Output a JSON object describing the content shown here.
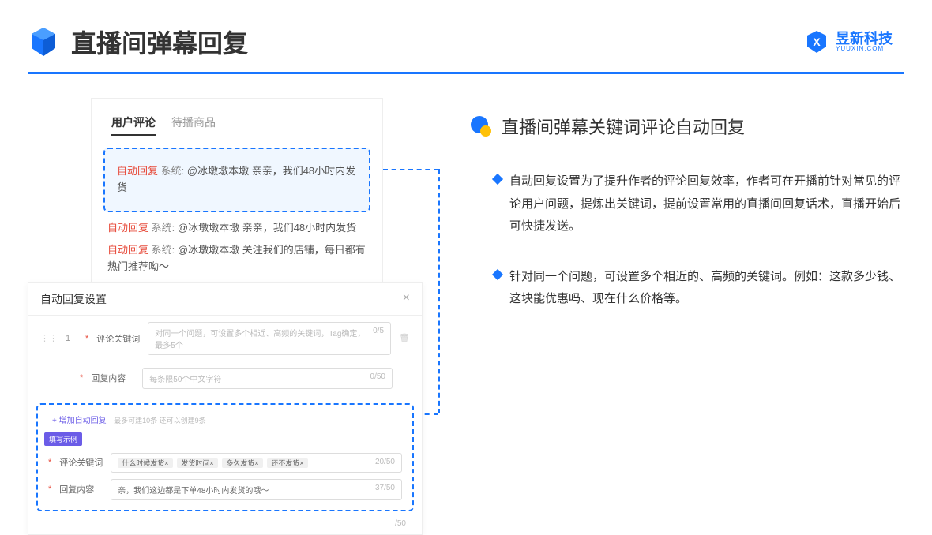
{
  "header": {
    "title": "直播间弹幕回复",
    "logo_name": "昱新科技",
    "logo_url": "YUUXIN.COM"
  },
  "comments": {
    "tab_active": "用户评论",
    "tab_inactive": "待播商品",
    "highlighted": {
      "tag": "自动回复",
      "sys": "系统:",
      "msg": "@冰墩墩本墩 亲亲，我们48小时内发货"
    },
    "line2": {
      "tag": "自动回复",
      "sys": "系统:",
      "msg": "@冰墩墩本墩 亲亲，我们48小时内发货"
    },
    "line3": {
      "tag": "自动回复",
      "sys": "系统:",
      "msg": "@冰墩墩本墩 关注我们的店铺，每日都有热门推荐呦～"
    }
  },
  "settings": {
    "title": "自动回复设置",
    "row_num": "1",
    "keyword_label": "评论关键词",
    "keyword_placeholder": "对同一个问题，可设置多个相近、高频的关键词，Tag确定，最多5个",
    "keyword_counter": "0/5",
    "content_label": "回复内容",
    "content_placeholder": "每条限50个中文字符",
    "content_counter": "0/50",
    "add_link": "+ 增加自动回复",
    "add_hint": "最多可建10条 还可以创建9条",
    "example_badge": "填写示例",
    "ex_keyword_label": "评论关键词",
    "ex_tags": [
      "什么时候发货×",
      "发货时间×",
      "多久发货×",
      "还不发货×"
    ],
    "ex_keyword_counter": "20/50",
    "ex_content_label": "回复内容",
    "ex_content_value": "亲，我们这边都是下单48小时内发货的哦～",
    "ex_content_counter": "37/50",
    "outer_counter": "/50"
  },
  "right": {
    "heading": "直播间弹幕关键词评论自动回复",
    "bullet1": "自动回复设置为了提升作者的评论回复效率，作者可在开播前针对常见的评论用户问题，提炼出关键词，提前设置常用的直播间回复话术，直播开始后可快捷发送。",
    "bullet2": "针对同一个问题，可设置多个相近的、高频的关键词。例如：这款多少钱、这块能优惠吗、现在什么价格等。"
  }
}
